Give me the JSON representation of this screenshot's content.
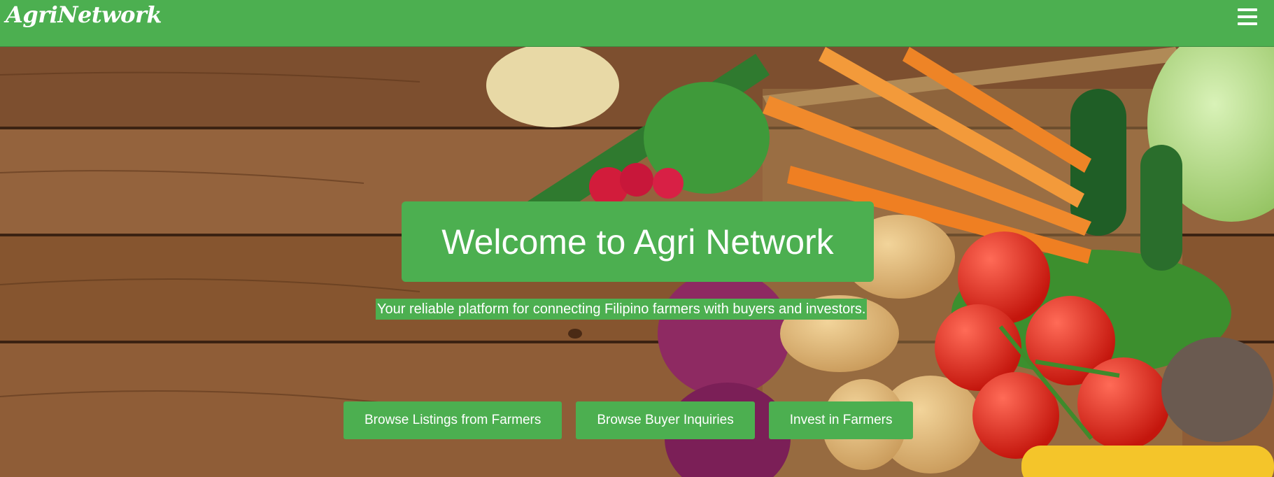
{
  "header": {
    "brand": "AgriNetwork",
    "menu_icon": "hamburger-menu-icon"
  },
  "hero": {
    "title": "Welcome to Agri Network",
    "subtitle": "Your reliable platform for connecting Filipino farmers with buyers and investors.",
    "background": "wooden-table-with-vegetables-image"
  },
  "actions": [
    {
      "label": "Browse Listings from Farmers"
    },
    {
      "label": "Browse Buyer Inquiries"
    },
    {
      "label": "Invest in Farmers"
    }
  ],
  "colors": {
    "primary": "#4caf50",
    "wood": "#8a5a36",
    "text_on_primary": "#ffffff"
  }
}
